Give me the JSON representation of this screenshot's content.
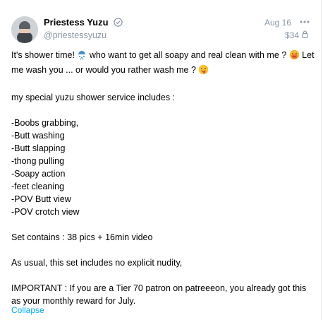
{
  "post": {
    "display_name": "Priestess Yuzu",
    "username": "@priestessyuzu",
    "date": "Aug 16",
    "price": "$34",
    "intro_part1": "It's shower time!",
    "intro_part2": " who want to get all soapy and real clean with me ?",
    "intro_part3": " Let me wash you ... or would you rather wash me ?",
    "services_heading": "my special yuzu shower service includes :",
    "services": [
      "-Boobs grabbing,",
      "-Butt washing",
      "-Butt slapping",
      "-thong pulling",
      "-Soapy action",
      "-feet cleaning",
      "-POV Butt view",
      "-POV crotch view"
    ],
    "set_contents": "Set contains : 38 pics + 16min video",
    "nudity_note": "As usual, this set includes no explicit nudity,",
    "important_note": "IMPORTANT : If you are a Tier 70 patron on patreeeon, you already got this as your monthly reward for July.",
    "collapse_label": "Collapse"
  },
  "icons": {
    "verified": "verified-icon",
    "more": "more-options-icon",
    "lock": "lock-icon",
    "shower": "shower-emoji-icon",
    "face": "hot-face-emoji-icon",
    "tongue": "tongue-wink-emoji-icon"
  },
  "colors": {
    "accent": "#00aff0",
    "muted": "#8a96a3"
  }
}
